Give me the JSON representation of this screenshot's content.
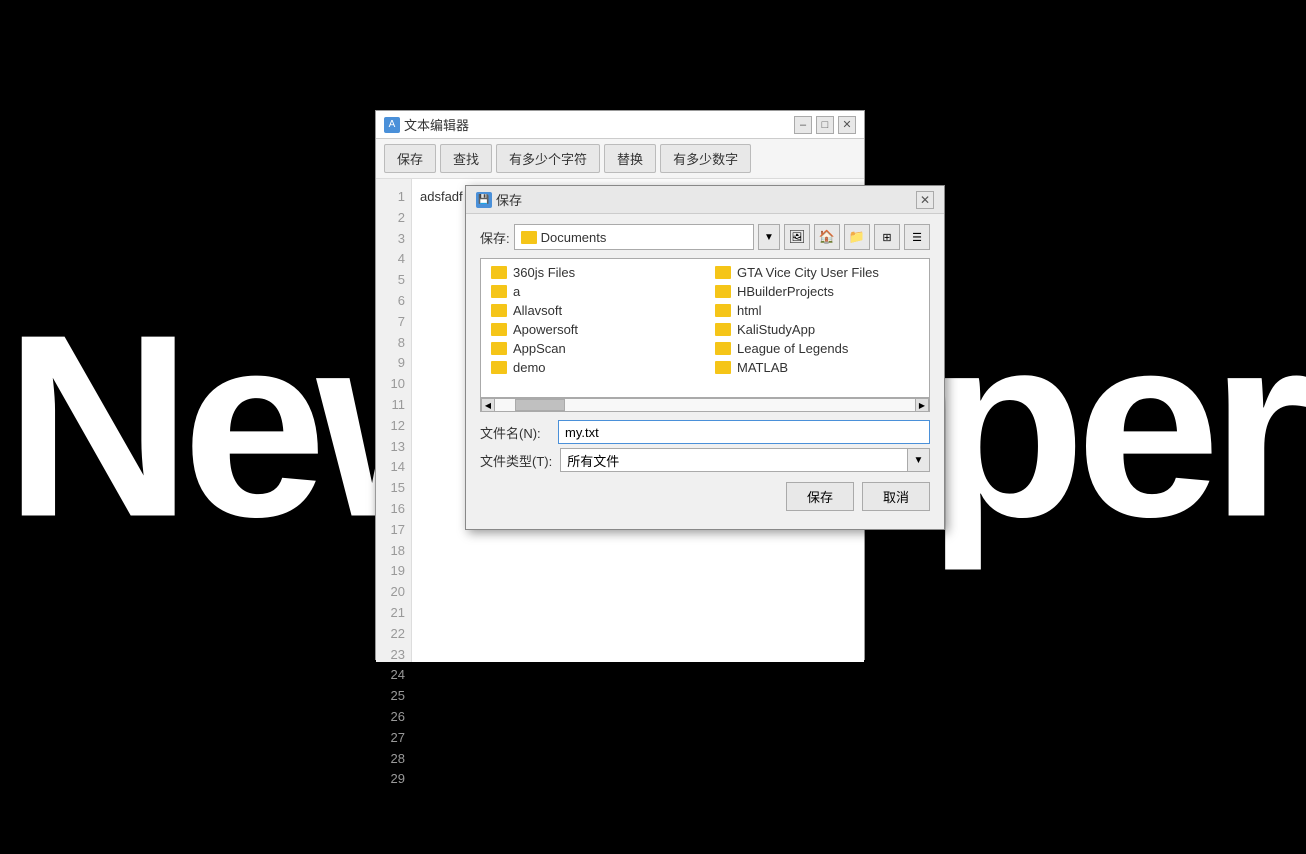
{
  "wallpaper": {
    "text": "Newspaper"
  },
  "textEditor": {
    "title": "文本编辑器",
    "titleIcon": "A",
    "toolbar": {
      "save": "保存",
      "find": "查找",
      "charCount": "有多少个字符",
      "replace": "替换",
      "numCount": "有多少数字"
    },
    "content": {
      "firstLine": "adsfadf"
    },
    "lineNumbers": [
      "1",
      "2",
      "3",
      "4",
      "5",
      "6",
      "7",
      "8",
      "9",
      "10",
      "11",
      "12",
      "13",
      "14",
      "15",
      "16",
      "17",
      "18",
      "19",
      "20",
      "21",
      "22",
      "23",
      "24",
      "25",
      "26",
      "27",
      "28",
      "29"
    ]
  },
  "saveDialog": {
    "title": "保存",
    "locationLabel": "保存:",
    "locationPath": "Documents",
    "fileListLeft": [
      "360js Files",
      "a",
      "Allavsoft",
      "Apowersoft",
      "AppScan",
      "demo"
    ],
    "fileListRight": [
      "GTA Vice City User Files",
      "HBuilderProjects",
      "html",
      "KaliStudyApp",
      "League of Legends",
      "MATLAB"
    ],
    "fileNameLabel": "文件名(N):",
    "fileNameValue": "my.txt",
    "fileTypeLabel": "文件类型(T):",
    "fileTypeValue": "所有文件",
    "saveButton": "保存",
    "cancelButton": "取消"
  }
}
